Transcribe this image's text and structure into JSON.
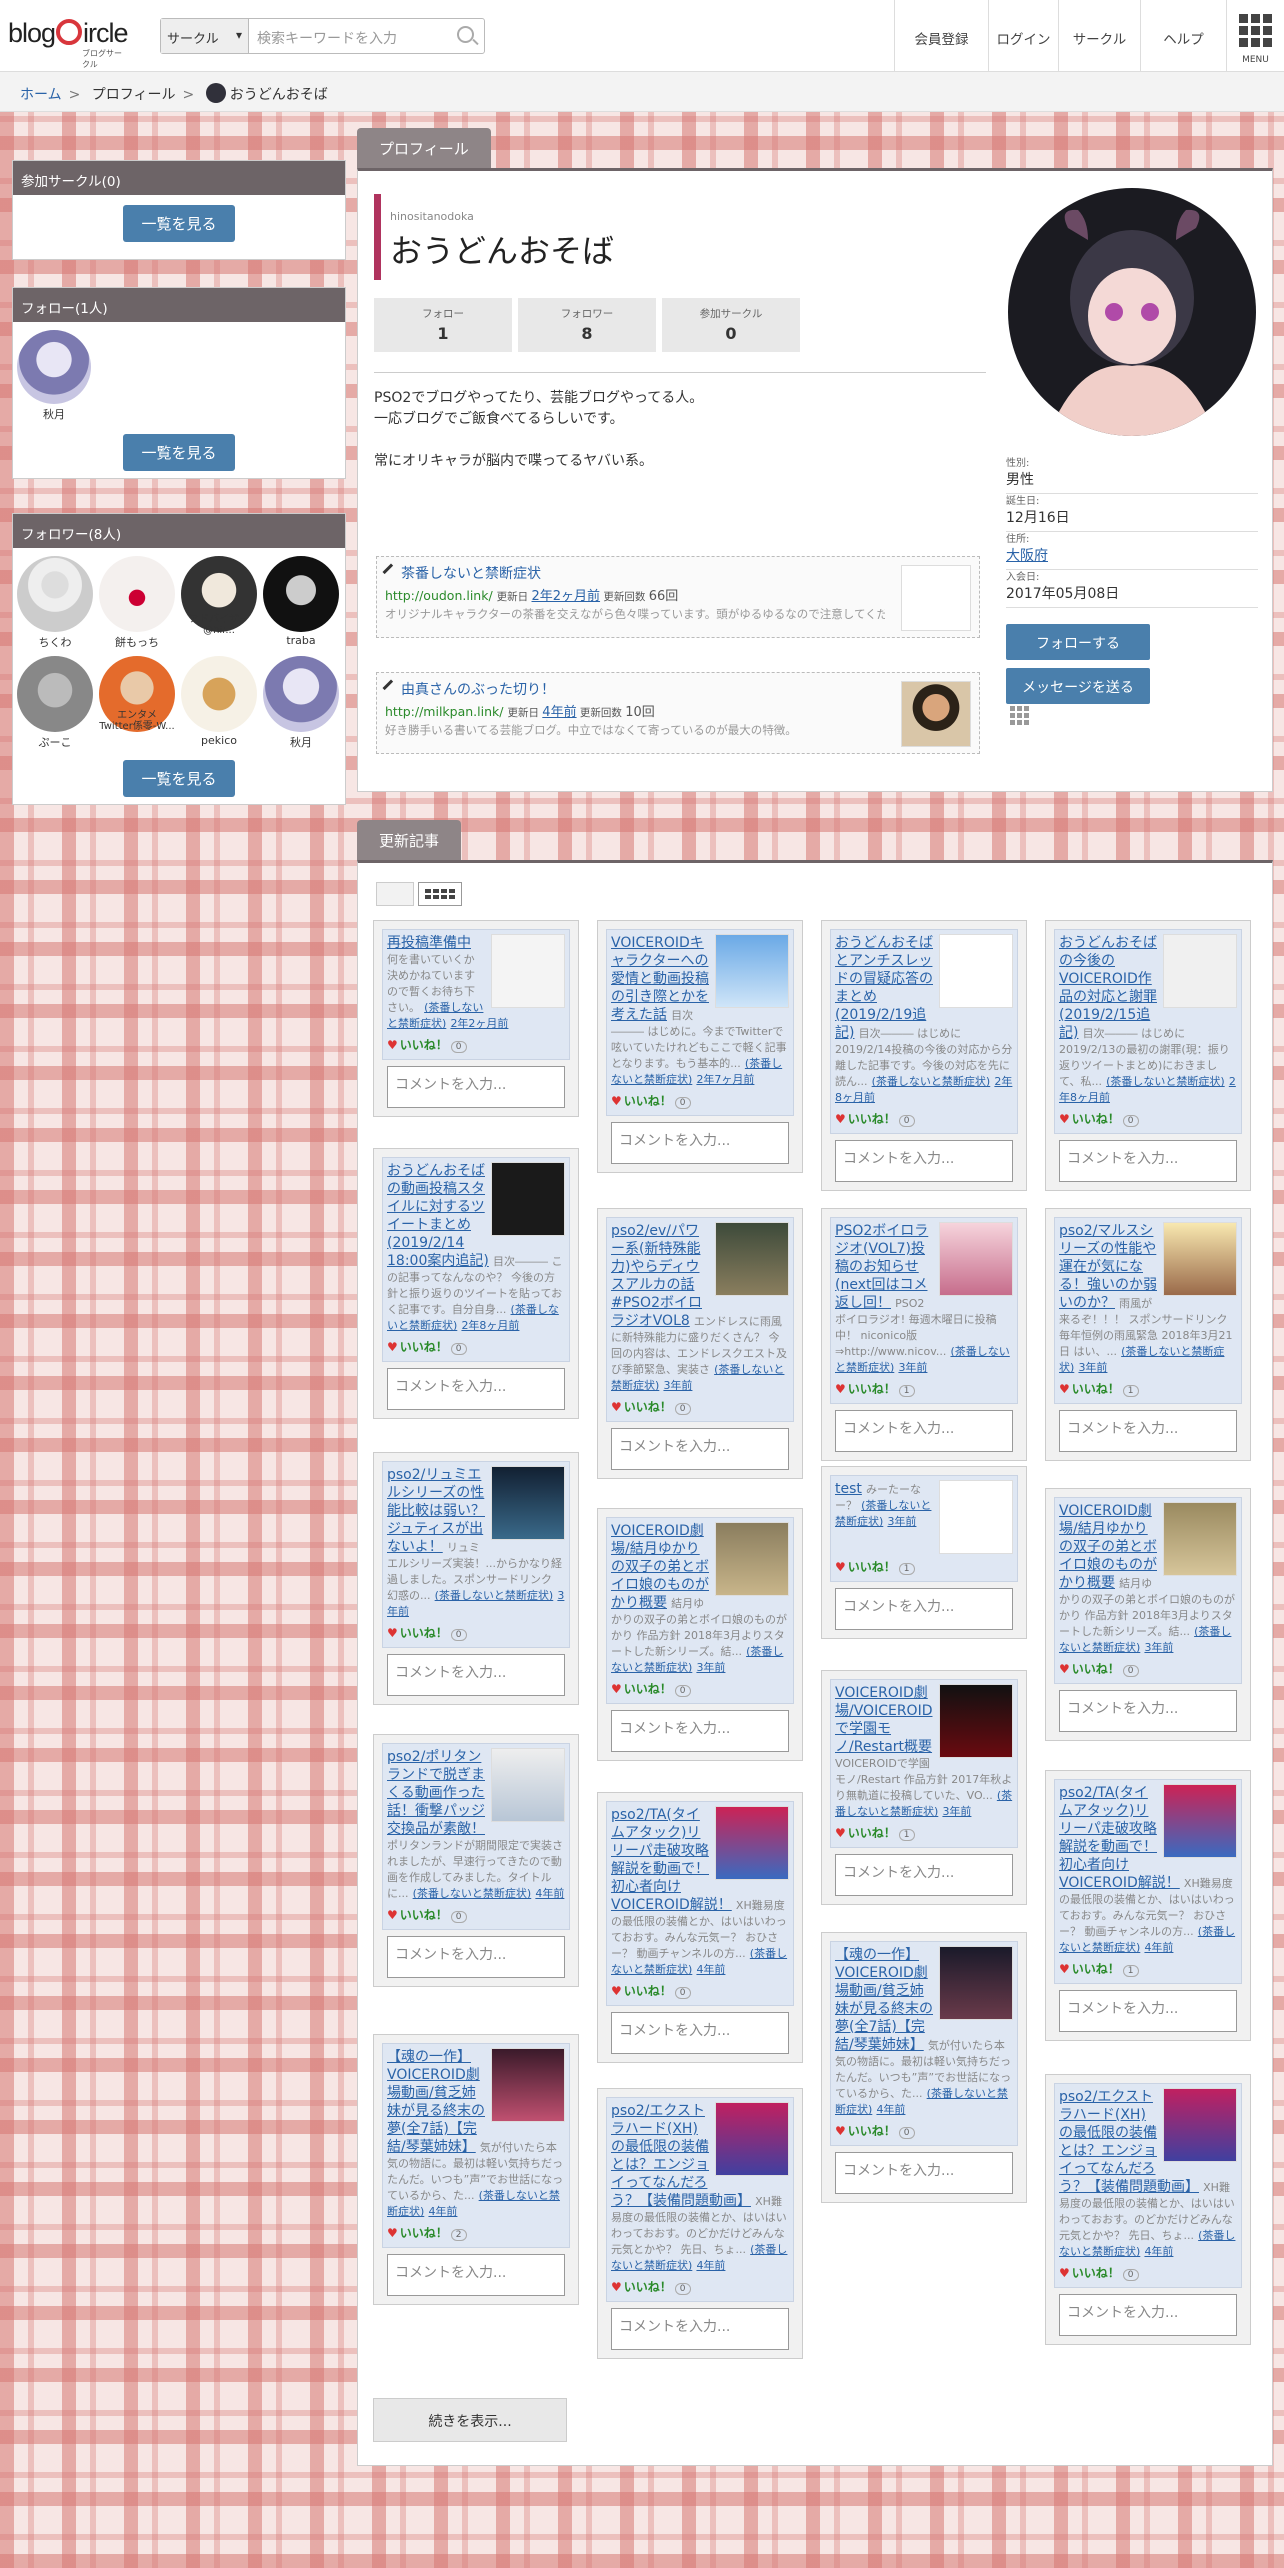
{
  "header": {
    "logo": "blogircle",
    "logo_sub": "ブログサークル",
    "search_scope": "サークル",
    "search_placeholder": "検索キーワードを入力",
    "nav": [
      "会員登録",
      "ログイン",
      "サークル",
      "ヘルプ"
    ],
    "menu": "MENU"
  },
  "breadcrumb": [
    "ホーム",
    "プロフィール",
    "おうどんおそば"
  ],
  "sidebar": {
    "circles": {
      "title": "参加サークル(0)",
      "button": "一覧を見る"
    },
    "follow": {
      "title": "フォロー(1人)",
      "users": [
        "秋月"
      ],
      "button": "一覧を見る"
    },
    "followers": {
      "title": "フォロワー(8人)",
      "users": [
        "ちくわ",
        "餅もっち",
        "アドバイザー@hir...",
        "traba",
        "ぷーこ",
        "エンタメ Twitter係零-W...",
        "pekico",
        "秋月"
      ],
      "button": "一覧を見る"
    }
  },
  "profile": {
    "tab": "プロフィール",
    "user_id": "hinositanodoka",
    "name": "おうどんおそば",
    "stats": [
      {
        "label": "フォロー",
        "value": "1"
      },
      {
        "label": "フォロワー",
        "value": "8"
      },
      {
        "label": "参加サークル",
        "value": "0"
      }
    ],
    "bio": "PSO2でブログやってたり、芸能ブログやってる人。\n一応ブログでご飯食べてるらしいです。\n\n常にオリキャラが脳内で喋ってるヤバい系。",
    "blogs": [
      {
        "title": "茶番しないと禁断症状",
        "url": "http://oudon.link/",
        "updated_label": "更新日",
        "updated": "2年2ヶ月前",
        "count_label": "更新回数",
        "count": "66回",
        "desc": "オリジナルキャラクターの茶番を交えながら色々喋っています。頭がゆるゆるなので注意してください。情報はよそ様が凄いのでほどほどで。プレイ感や私見を述べて..."
      },
      {
        "title": "由真さんのぶった切り！",
        "url": "http://milkpan.link/",
        "updated_label": "更新日",
        "updated": "4年前",
        "count_label": "更新回数",
        "count": "10回",
        "desc": "好き勝手いる書いてる芸能ブログ。中立ではなくて寄っているのが最大の特徴。"
      }
    ],
    "info": [
      {
        "label": "性別:",
        "value": "男性"
      },
      {
        "label": "誕生日:",
        "value": "12月16日"
      },
      {
        "label": "住所:",
        "value": "大阪府"
      },
      {
        "label": "入会日:",
        "value": "2017年05月08日"
      }
    ],
    "follow_btn": "フォローする",
    "message_btn": "メッセージを送る"
  },
  "articles": {
    "tab": "更新記事",
    "comment_placeholder": "コメントを入力...",
    "like_label": "いいね！",
    "more": "続きを表示...",
    "cards": [
      {
        "title": "再投稿準備中",
        "excerpt": "何を書いていくか決めかねていますので暫くお待ち下さい。",
        "blog": "(茶番しないと禁断症状)",
        "time": "2年2ヶ月前",
        "likes": "0"
      },
      {
        "title": "VOICEROIDキャラクターへの愛情と動画投稿の引き際とかを考えた話",
        "excerpt": "目次 ――― はじめに。今までTwitterで呟いていたけれどもここで軽く記事となります。もう基本的...",
        "blog": "(茶番しないと禁断症状)",
        "time": "2年7ヶ月前",
        "likes": "0"
      },
      {
        "title": "おうどんおそばとアンチスレッドの冒疑応答のまとめ(2019/2/19追記)",
        "excerpt": "目次――― はじめに 2019/2/14投稿の今後の対応から分離した記事です。今後の対応を先に読ん...",
        "blog": "(茶番しないと禁断症状)",
        "time": "2年8ヶ月前",
        "likes": "0"
      },
      {
        "title": "おうどんおそばの今後のVOICEROID作品の対応と謝罪(2019/2/15追記)",
        "excerpt": "目次――― はじめに 2019/2/13の最初の謝罪(現：振り返りツイートまとめ)におきまして、私...",
        "blog": "(茶番しないと禁断症状)",
        "time": "2年8ヶ月前",
        "likes": "0"
      },
      {
        "title": "おうどんおそばの動画投稿スタイルに対するツイートまとめ(2019/2/14 18:00案内追記)",
        "excerpt": "目次――― この記事ってなんなのや？ 今後の方針と振り返りのツイートを貼っておく記事です。自分自身...",
        "blog": "(茶番しないと禁断症状)",
        "time": "2年8ヶ月前",
        "likes": "0"
      },
      {
        "title": "pso2/ev/パワー系(新特殊能力)やらディウスアルカの話#PSO2ボイロラジオVOL8",
        "excerpt": "エンドレスに雨風に新特殊能力に盛りだくさん？ 今回の内容は、エンドレスクエスト及び季節緊急、実装さ",
        "blog": "(茶番しないと禁断症状)",
        "time": "3年前",
        "likes": "0"
      },
      {
        "title": "PSO2ボイロラジオ(VOL7)投稿のお知らせ(next回はコメ返し回！",
        "excerpt": "PSO2ボイロラジオ! 毎週木曜日に投稿中！ niconico版⇒http://www.nicov...",
        "blog": "(茶番しないと禁断症状)",
        "time": "3年前",
        "likes": "1"
      },
      {
        "title": "pso2/マルスシリーズの性能や運在が気になる！強いのか弱いのか？",
        "excerpt": "雨風が来るぞ！！！ スポンサードリンク 毎年恒例の雨風緊急 2018年3月21日 はい、...",
        "blog": "(茶番しないと禁断症状)",
        "time": "3年前",
        "likes": "1"
      },
      {
        "title": "pso2/リュミエルシリーズの性能比較は弱い？ジュティスが出ないよ！",
        "excerpt": "リュミエルシリーズ実装！...からかなり経過しました。スポンサードリンク 幻惑の...",
        "blog": "(茶番しないと禁断症状)",
        "time": "3年前",
        "likes": "0"
      },
      {
        "title": "VOICEROID劇場/結月ゆかりの双子の弟とボイロ娘のものがかり概要",
        "excerpt": "結月ゆかりの双子の弟とボイロ娘のものがかり 作品方針 2018年3月よりスタートした新シリーズ。結...",
        "blog": "(茶番しないと禁断症状)",
        "time": "3年前",
        "likes": "0"
      },
      {
        "title": "test",
        "excerpt": "みーたーなー？",
        "blog": "(茶番しないと禁断症状)",
        "time": "3年前",
        "likes": "1"
      },
      {
        "title": "VOICEROID劇場/結月ゆかりの双子の弟とボイロ娘のものがかり概要",
        "excerpt": "結月ゆかりの双子の弟とボイロ娘のものがかり 作品方針 2018年3月よりスタートした新シリーズ。結...",
        "blog": "(茶番しないと禁断症状)",
        "time": "3年前",
        "likes": "0"
      },
      {
        "title": "pso2/ポリタンランドで脱ぎまくる動画作った話！衝撃パッジ交換品が素敵！",
        "excerpt": "ポリタンランドが期間限定で実装されましたが、早速行ってきたので動画を作成してみました。タイトルに...",
        "blog": "(茶番しないと禁断症状)",
        "time": "4年前",
        "likes": "0"
      },
      {
        "title": "pso2/TA(タイムアタック)リリーパ走破攻略解説を動画で！初心者向けVOICEROID解説！",
        "excerpt": "XH難易度の最低限の装備とか、はいはいわっておおす。みんな元気ー？ おひさー？ 動画チャンネルの方...",
        "blog": "(茶番しないと禁断症状)",
        "time": "4年前",
        "likes": "0"
      },
      {
        "title": "VOICEROID劇場/VOICEROIDで学園モノ/Restart概要",
        "excerpt": "VOICEROIDで学園モノ/Restart 作品方針 2017年秋より無軌道に投稿していた、VO...",
        "blog": "(茶番しないと禁断症状)",
        "time": "3年前",
        "likes": "1"
      },
      {
        "title": "pso2/TA(タイムアタック)リリーパ走破攻略解説を動画で！初心者向けVOICEROID解説！",
        "excerpt": "XH難易度の最低限の装備とか、はいはいわっておおす。みんな元気ー？ おひさー？ 動画チャンネルの方...",
        "blog": "(茶番しないと禁断症状)",
        "time": "4年前",
        "likes": "1"
      },
      {
        "title": "【魂の一作】VOICEROID劇場動画/貧乏姉妹が見る終末の夢(全7話)【完結/琴葉姉妹】",
        "excerpt": "気が付いたら本気の物語に。最初は軽い気持ちだったんだ。いつも”声”でお世話になっているから、た...",
        "blog": "(茶番しないと禁断症状)",
        "time": "4年前",
        "likes": "2"
      },
      {
        "title": "pso2/エクストラハード(XH)の最低限の装備とは？エンジョイってなんだろう？【装備問題動画】",
        "excerpt": "XH難易度の最低限の装備とか、はいはいわっておおす。のどかだけどみんな元気とかや？ 先日、ちょ...",
        "blog": "(茶番しないと禁断症状)",
        "time": "4年前",
        "likes": "0"
      },
      {
        "title": "【魂の一作】VOICEROID劇場動画/貧乏姉妹が見る終末の夢(全7話)【完結/琴葉姉妹】",
        "excerpt": "気が付いたら本気の物語に。最初は軽い気持ちだったんだ。いつも”声”でお世話になっているから、た...",
        "blog": "(茶番しないと禁断症状)",
        "time": "4年前",
        "likes": "0"
      },
      {
        "title": "pso2/エクストラハード(XH)の最低限の装備とは？エンジョイってなんだろう？【装備問題動画】",
        "excerpt": "XH難易度の最低限の装備とか、はいはいわっておおす。のどかだけどみんな元気とかや？ 先日、ちょ...",
        "blog": "(茶番しないと禁断症状)",
        "time": "4年前",
        "likes": "0"
      }
    ]
  }
}
